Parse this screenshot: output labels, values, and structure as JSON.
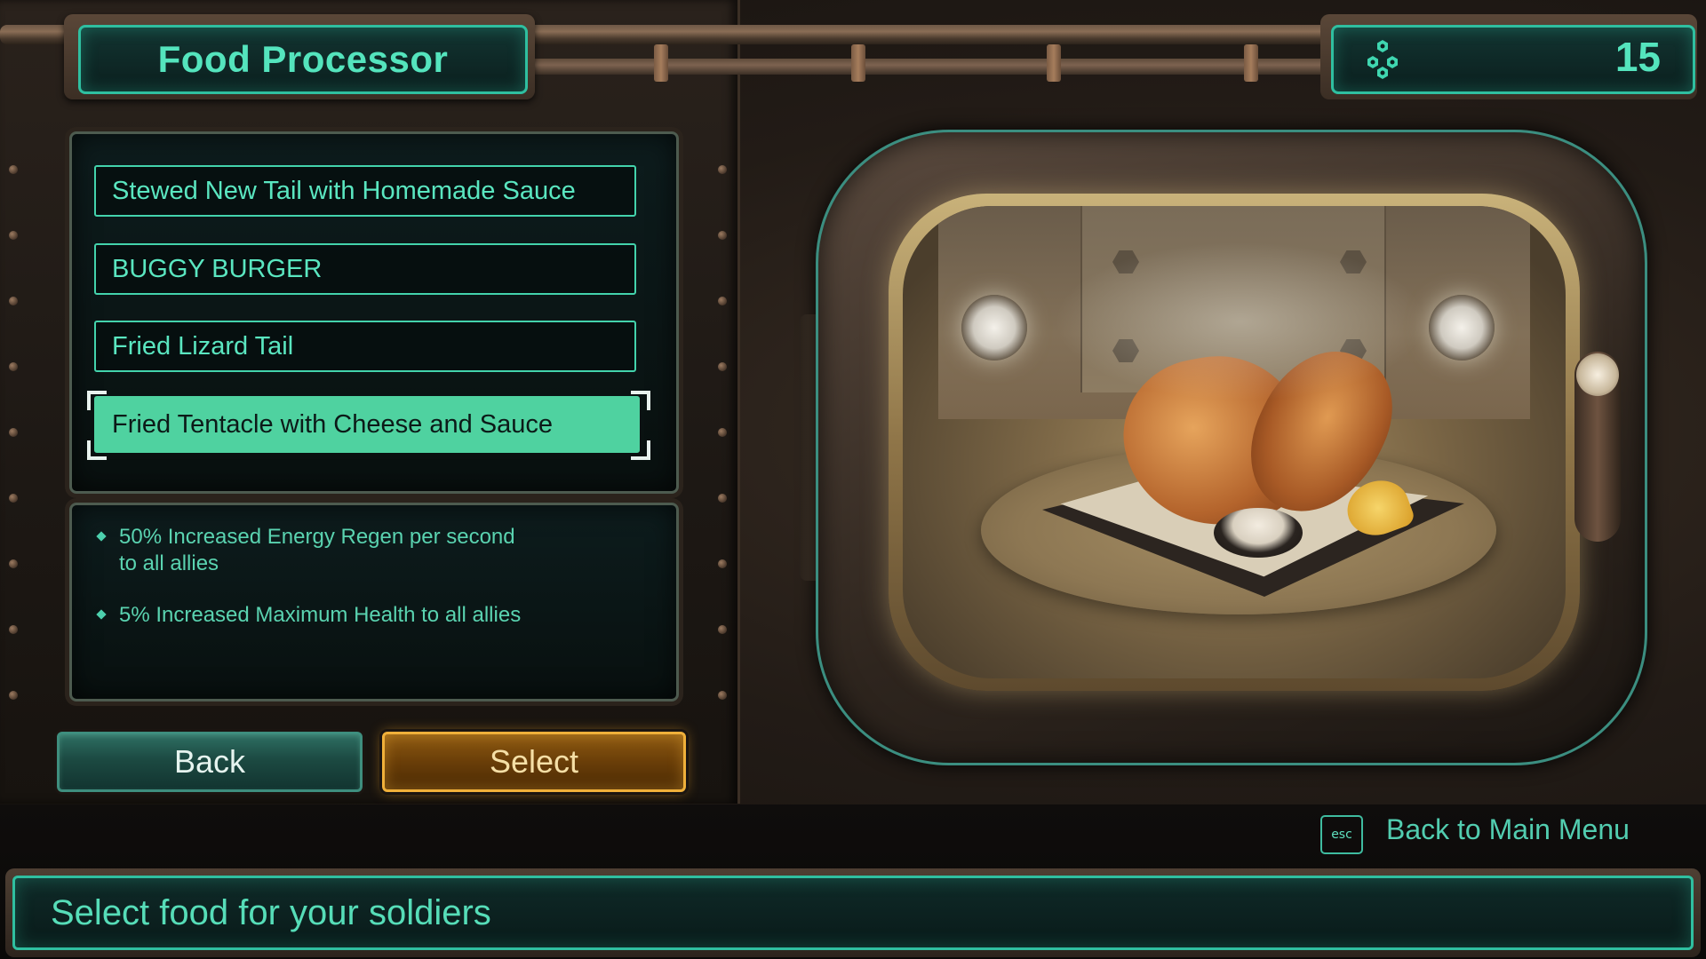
{
  "header": {
    "title": "Food Processor",
    "currency_icon": "cog-cluster-icon",
    "currency_value": "15"
  },
  "recipes": {
    "items": [
      {
        "label": "Stewed New Tail with Homemade Sauce",
        "selected": false
      },
      {
        "label": "BUGGY BURGER",
        "selected": false
      },
      {
        "label": "Fried Lizard Tail",
        "selected": false
      },
      {
        "label": "Fried Tentacle with Cheese and Sauce",
        "selected": true
      }
    ]
  },
  "description": {
    "effects": [
      {
        "line1": "50% Increased Energy Regen per second",
        "line2": "to all allies"
      },
      {
        "line1": "5% Increased Maximum Health to all allies",
        "line2": ""
      }
    ]
  },
  "buttons": {
    "back_label": "Back",
    "select_label": "Select"
  },
  "footer": {
    "esc_key": "esc",
    "back_to_main": "Back to Main Menu",
    "hint": "Select food for your soldiers"
  },
  "colors": {
    "accent": "#54e4bd",
    "selected_fill": "#4fd2a0",
    "select_button_border": "#f0b03a"
  }
}
